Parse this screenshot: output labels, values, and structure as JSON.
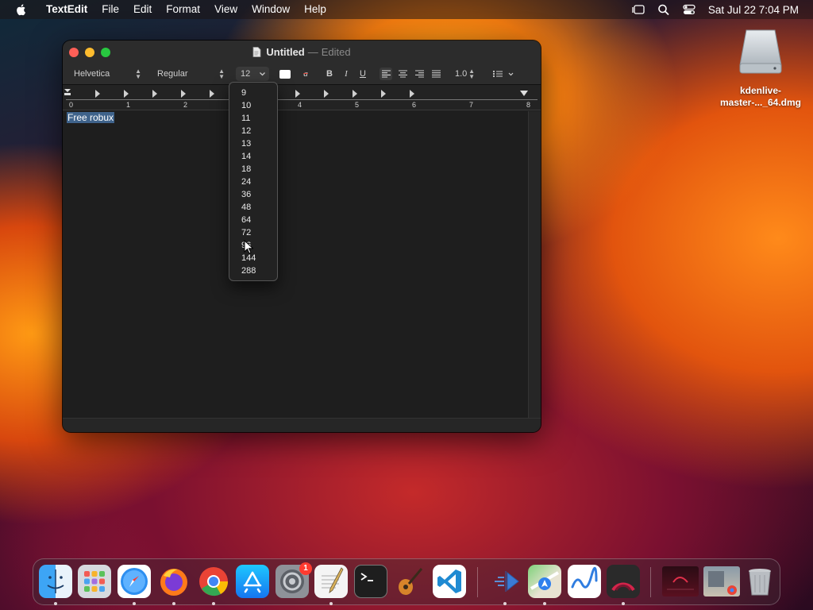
{
  "menubar": {
    "app": "TextEdit",
    "items": [
      "File",
      "Edit",
      "Format",
      "View",
      "Window",
      "Help"
    ],
    "clock": "Sat Jul 22  7:04 PM"
  },
  "desktop": {
    "icon_label_1": "kdenlive-",
    "icon_label_2": "master-..._64.dmg"
  },
  "window": {
    "title": "Untitled",
    "separator": "—",
    "status": "Edited",
    "toolbar": {
      "font_family": "Helvetica",
      "font_style": "Regular",
      "font_size": "12",
      "highlight": "a",
      "bold": "B",
      "italic": "I",
      "underline": "U",
      "line_spacing": "1.0"
    },
    "ruler_numbers": [
      "0",
      "1",
      "2",
      "3",
      "4",
      "5",
      "6",
      "7",
      "8"
    ],
    "document_text": "Free robux"
  },
  "font_size_menu": {
    "options": [
      "9",
      "10",
      "11",
      "12",
      "13",
      "14",
      "18",
      "24",
      "36",
      "48",
      "64",
      "72",
      "96",
      "144",
      "288"
    ]
  },
  "dock": {
    "apps": [
      "Finder",
      "Launchpad",
      "Safari",
      "Firefox",
      "Chrome",
      "App Store",
      "System Settings",
      "TextEdit",
      "Terminal",
      "GarageBand",
      "Visual Studio Code",
      "Kdenlive",
      "Maps",
      "Freeform",
      "Instruments",
      "Recent Item",
      "Recent Item",
      "Trash"
    ],
    "settings_badge": "1"
  },
  "colors": {
    "selection": "#3f638b",
    "close": "#fe5f57",
    "minimize": "#febc2e",
    "maximize": "#28c840"
  }
}
